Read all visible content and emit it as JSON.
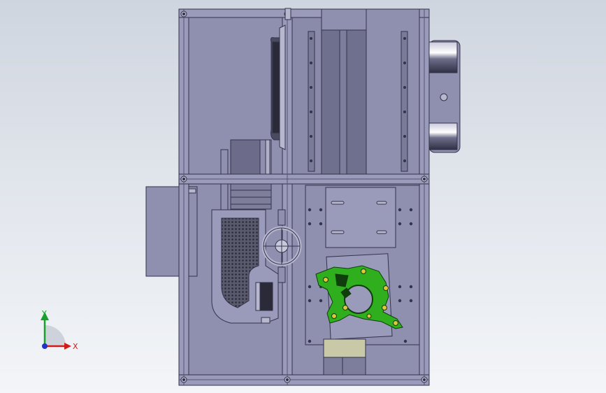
{
  "viewport": {
    "background_top": "#cfd5df",
    "background_bottom": "#f3f5f8",
    "model_color": "#8f8fb0",
    "edge_color": "#33334a",
    "part_highlight_color": "#2fae1e"
  },
  "triad": {
    "x_label": "X",
    "y_label": "Y",
    "x_axis_color": "#d11a1a",
    "y_axis_color": "#18a02c",
    "origin_color": "#2233cc"
  }
}
